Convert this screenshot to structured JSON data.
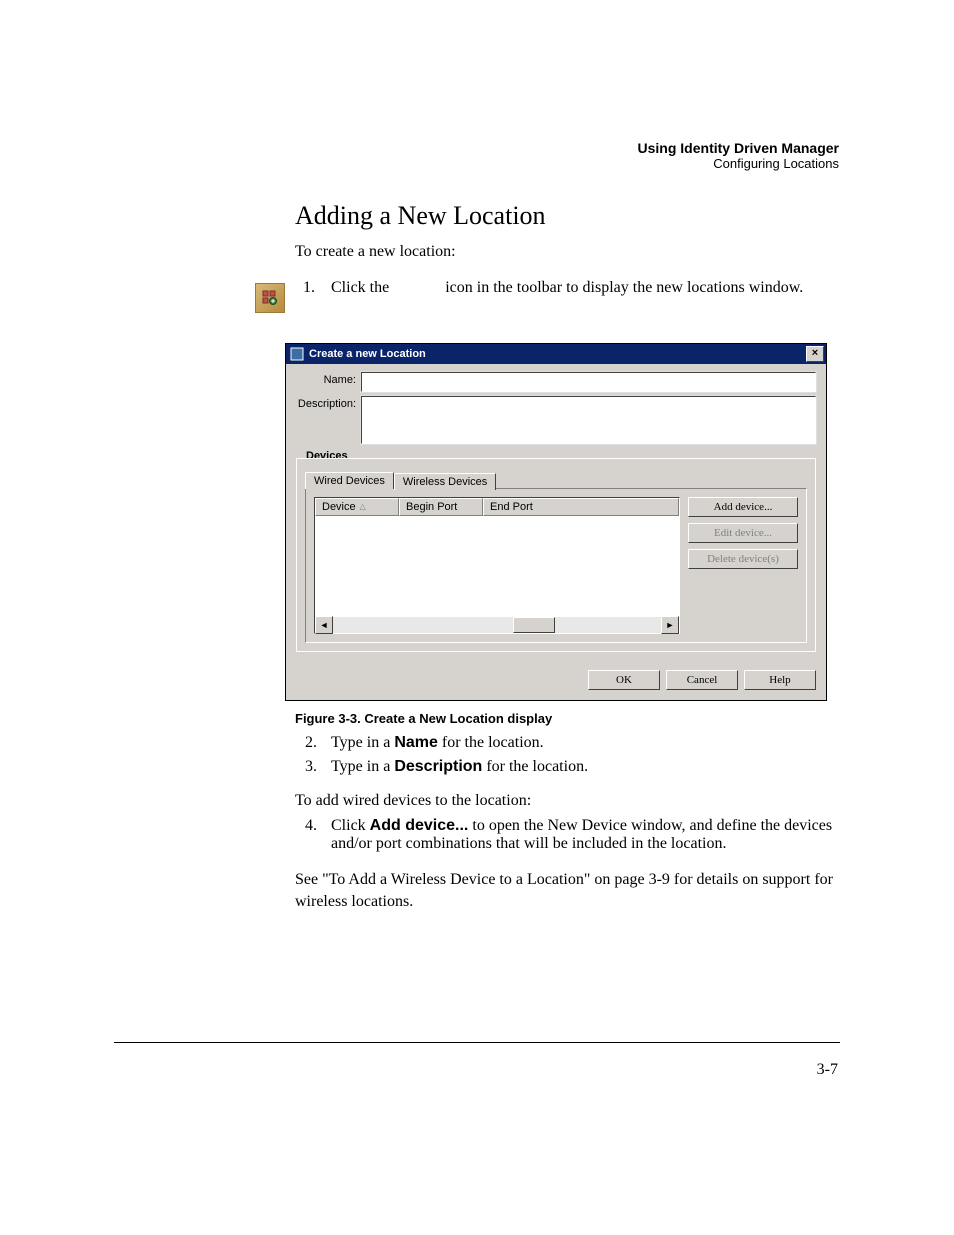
{
  "header": {
    "title": "Using Identity Driven Manager",
    "subtitle": "Configuring Locations"
  },
  "section_title": "Adding a New Location",
  "intro": "To create a new location:",
  "step1": {
    "num": "1.",
    "pre": "Click the ",
    "post": " icon in the toolbar to display the new locations window."
  },
  "dialog": {
    "title": "Create a new Location",
    "close": "×",
    "name_label": "Name:",
    "name_value": "",
    "desc_label": "Description:",
    "desc_value": "",
    "group_label": "Devices",
    "tab_wired": "Wired Devices",
    "tab_wireless": "Wireless Devices",
    "col_device": "Device",
    "col_begin": "Begin Port",
    "col_end": "End Port",
    "btn_add": "Add device...",
    "btn_edit": "Edit device...",
    "btn_delete": "Delete device(s)",
    "btn_ok": "OK",
    "btn_cancel": "Cancel",
    "btn_help": "Help",
    "scroll_left": "◄",
    "scroll_right": "►"
  },
  "figure_caption": "Figure 3-3. Create a New Location display",
  "step2": {
    "num": "2.",
    "pre": "Type in a ",
    "bold": "Name",
    "post": " for the location."
  },
  "step3": {
    "num": "3.",
    "pre": "Type in a ",
    "bold": "Description",
    "post": " for the location."
  },
  "wired_intro": "To add wired devices to the location:",
  "step4": {
    "num": "4.",
    "pre": "Click ",
    "bold": "Add device...",
    "post": " to open the New Device window, and define the devices and/or port combinations that will be included in the location."
  },
  "xref": "See \"To Add a Wireless Device to a Location\" on page 3-9 for details on support for wireless locations.",
  "page_num": "3-7"
}
